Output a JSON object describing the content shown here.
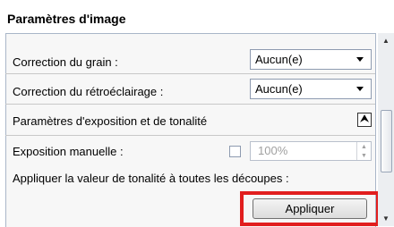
{
  "header": {
    "title": "Paramètres d'image"
  },
  "grain": {
    "label": "Correction du grain :",
    "value": "Aucun(e)"
  },
  "backlight": {
    "label": "Correction du rétroéclairage :",
    "value": "Aucun(e)"
  },
  "exposure_section": {
    "title": "Paramètres d'exposition et de tonalité",
    "collapse_glyph": "⮝"
  },
  "manual_exposure": {
    "label": "Exposition manuelle :",
    "checked": false,
    "value": "100%"
  },
  "apply_tone": {
    "label": "Appliquer la valeur de tonalité à toutes les découpes :",
    "button_label": "Appliquer"
  },
  "colors": {
    "highlight": "#e11e1e",
    "border": "#a9b6c8"
  },
  "icons": {
    "collapse": "double-chevron-up-icon",
    "dropdown": "dropdown-arrow-icon",
    "scroll_up": "scroll-up-arrow-icon",
    "scroll_down": "scroll-down-arrow-icon"
  }
}
